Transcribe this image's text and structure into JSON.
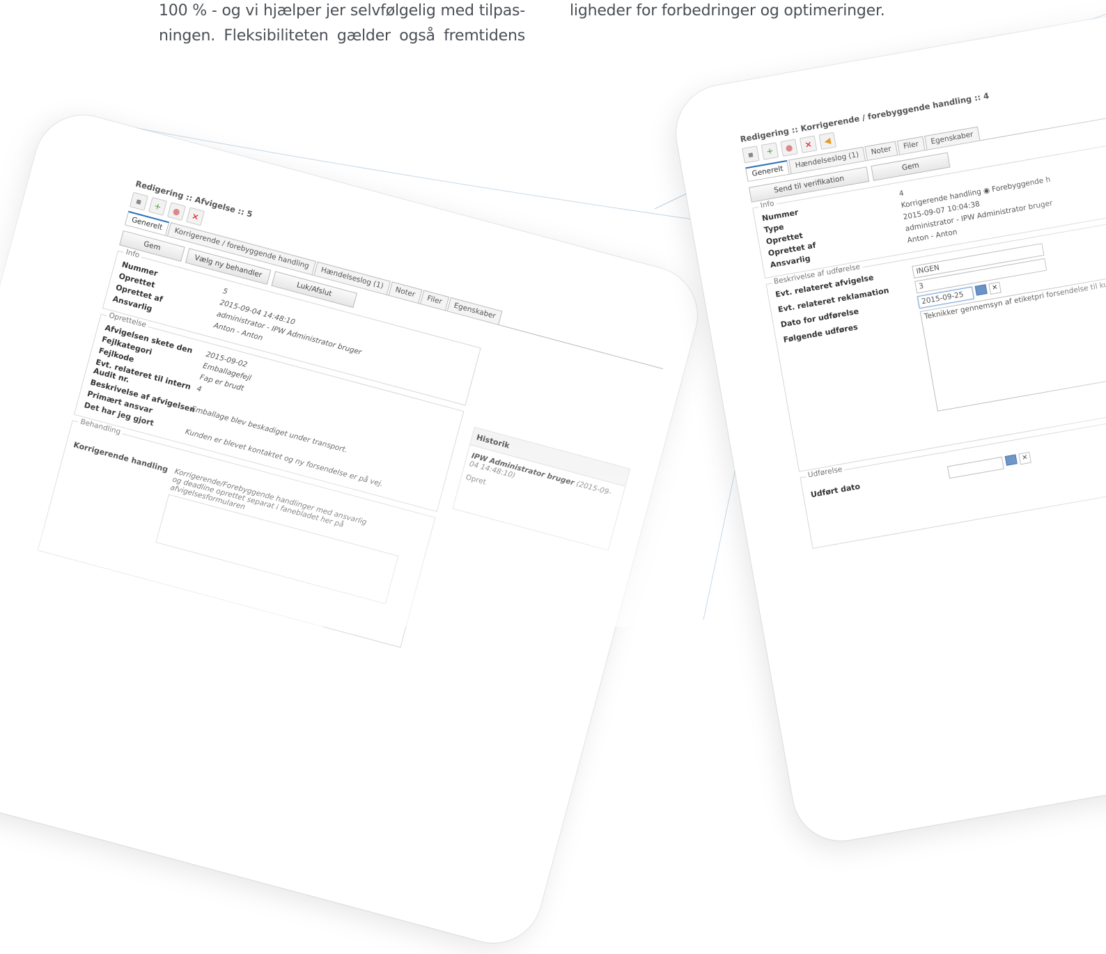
{
  "intro_text": {
    "left_line1": "100 % - og vi hjælper jer selvfølgelig med tilpas-",
    "left_line2": "ningen. Fleksibiliteten gælder også fremtidens",
    "right_line1": "ligheder for forbedringer og optimeringer."
  },
  "left_screen": {
    "title": "Redigering :: Afvigelse :: 5",
    "toolbar_icons": [
      "save-icon",
      "add-icon",
      "comment-icon",
      "delete-icon"
    ],
    "tabs": [
      "Generelt",
      "Korrigerende / forebyggende handling",
      "Hændelseslog (1)",
      "Noter",
      "Filer",
      "Egenskaber"
    ],
    "buttons": [
      "Gem",
      "Vælg ny behandler",
      "Luk/Afslut"
    ],
    "info": {
      "legend": "Info",
      "rows": [
        {
          "label": "Nummer",
          "value": "5"
        },
        {
          "label": "Oprettet",
          "value": "2015-09-04 14:48:10"
        },
        {
          "label": "Oprettet af",
          "value": "administrator - IPW Administrator bruger"
        },
        {
          "label": "Ansvarlig",
          "value": "Anton - Anton"
        }
      ]
    },
    "oprettelse": {
      "legend": "Oprettelse",
      "rows": [
        {
          "label": "Afvigelsen skete den",
          "value": "2015-09-02"
        },
        {
          "label": "Fejlkategori",
          "value": "Emballagefejl"
        },
        {
          "label": "Fejlkode",
          "value": "Fap er brudt"
        },
        {
          "label": "Evt. relateret til intern Audit nr.",
          "value": "4"
        },
        {
          "label": "Beskrivelse af afvigelsen",
          "value": "Emballage blev beskadiget under transport."
        },
        {
          "label": "Primært ansvar",
          "value": ""
        },
        {
          "label": "Det har jeg gjort",
          "value": "Kunden er blevet kontaktet og ny forsendelse er på vej."
        }
      ]
    },
    "behandling": {
      "legend": "Behandling",
      "label": "Korrigerende handling",
      "note": "Korrigerende/Forebyggende handlinger med ansvarlig og deadline oprettet separat i fanebladet her på afvigelsesformularen"
    },
    "history": {
      "header": "Historik",
      "user": "IPW Administrator bruger",
      "timestamp": "(2015-09-04 14:48:10)",
      "action": "Opret"
    }
  },
  "right_screen": {
    "title": "Redigering :: Korrigerende / forebyggende handling :: 4",
    "toolbar_icons": [
      "save-icon",
      "add-icon",
      "comment-icon",
      "delete-icon",
      "back-icon"
    ],
    "tabs": [
      "Generelt",
      "Hændelseslog (1)",
      "Noter",
      "Filer",
      "Egenskaber"
    ],
    "buttons": [
      "Send til verifikation",
      "Gem"
    ],
    "info": {
      "legend": "Info",
      "rows": [
        {
          "label": "Nummer",
          "value": "4"
        },
        {
          "label": "Type",
          "value": "Korrigerende handling  ◉  Forebyggende h"
        },
        {
          "label": "Oprettet",
          "value": "2015-09-07 10:04:38"
        },
        {
          "label": "Oprettet af",
          "value": "administrator - IPW Administrator bruger"
        },
        {
          "label": "Ansvarlig",
          "value": "Anton - Anton"
        }
      ]
    },
    "beskrivelse": {
      "legend": "Beskrivelse af udførelse",
      "rows": [
        {
          "label": "Evt. relateret afvigelse",
          "value": "INGEN"
        },
        {
          "label": "Evt. relateret reklamation",
          "value": "3"
        },
        {
          "label": "Dato for udførelse",
          "value": "2015-09-25"
        },
        {
          "label": "Følgende udføres",
          "value": "Teknikker gennemsyn af etiketpri forsendelse til kunde."
        }
      ]
    },
    "udforelse": {
      "legend": "Udførelse",
      "label": "Udført dato"
    }
  }
}
